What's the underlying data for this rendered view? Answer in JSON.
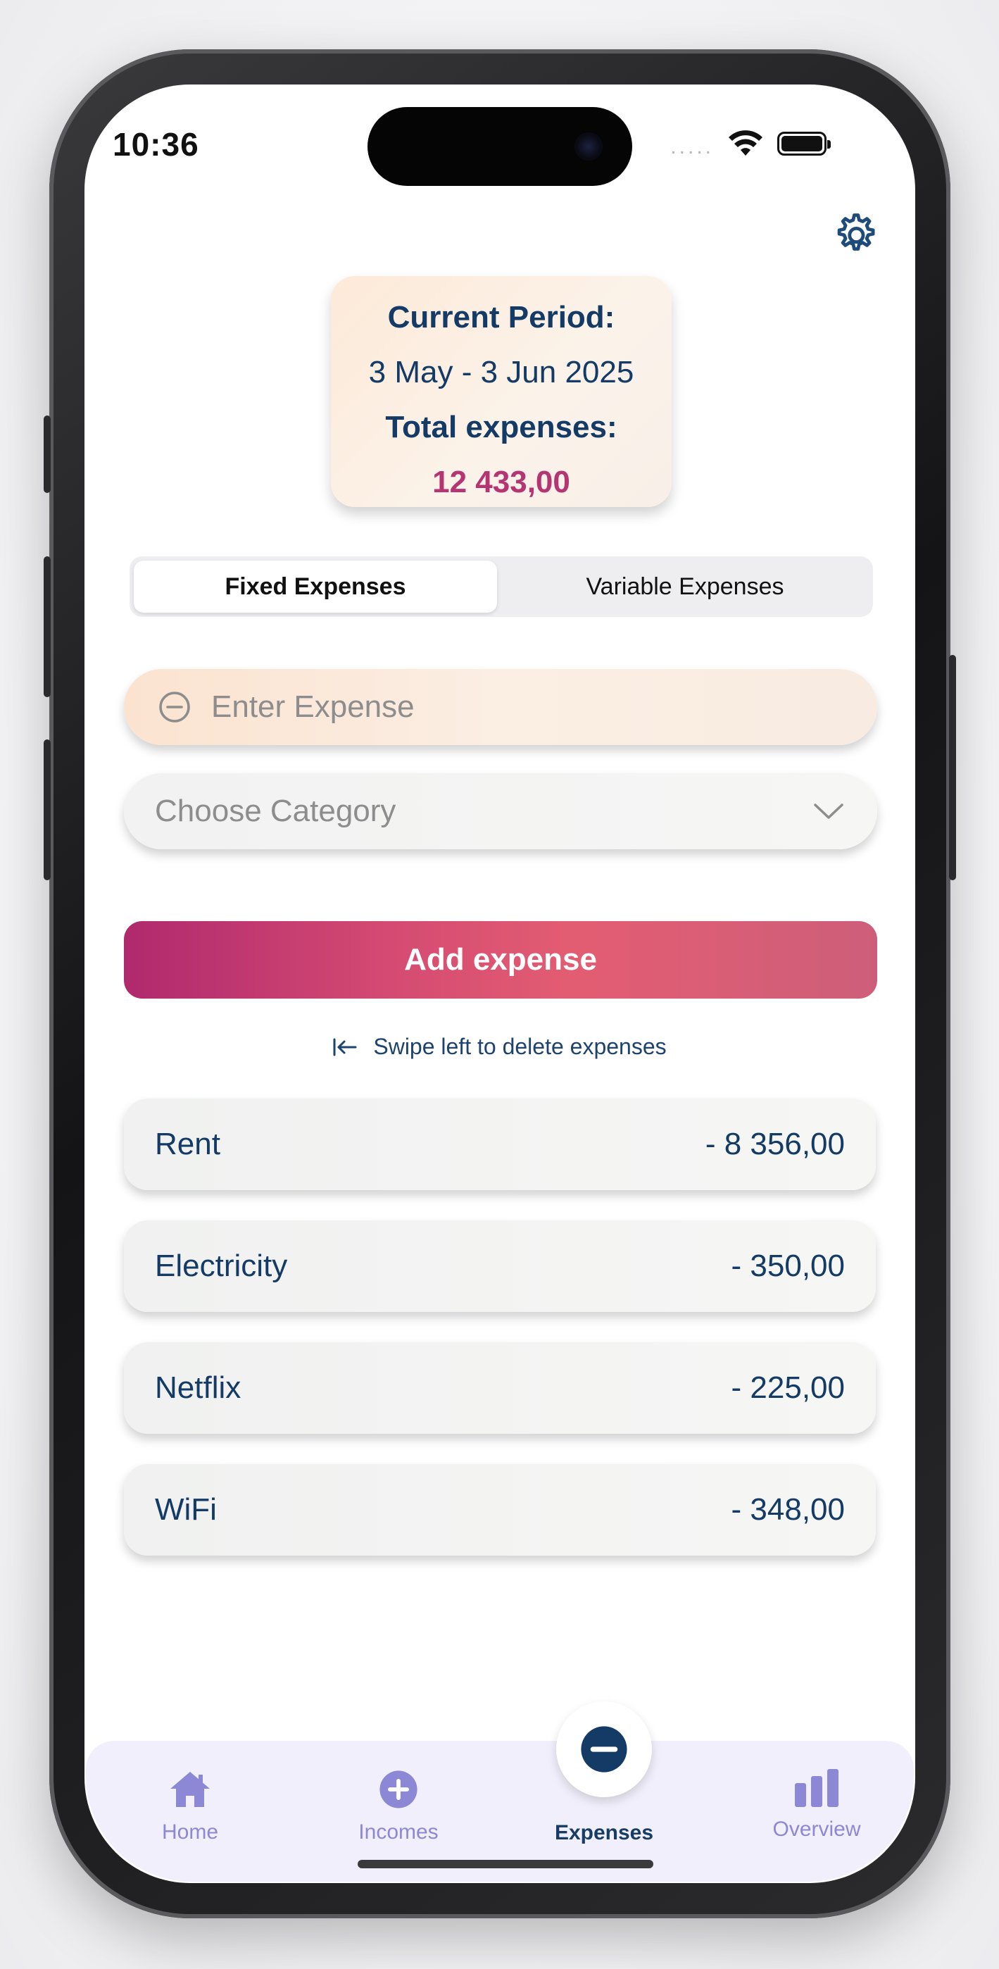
{
  "status_bar": {
    "time": "10:36",
    "signal": "....."
  },
  "summary": {
    "period_label": "Current Period:",
    "period_range": "3 May - 3 Jun 2025",
    "total_label": "Total expenses:",
    "total_value": "12 433,00"
  },
  "segments": {
    "fixed": "Fixed Expenses",
    "variable": "Variable Expenses",
    "selected": "fixed"
  },
  "form": {
    "expense_placeholder": "Enter Expense",
    "category_placeholder": "Choose Category",
    "add_label": "Add expense"
  },
  "hint": "Swipe left to delete expenses",
  "expenses": [
    {
      "name": "Rent",
      "amount": "- 8 356,00"
    },
    {
      "name": "Electricity",
      "amount": "- 350,00"
    },
    {
      "name": "Netflix",
      "amount": "- 225,00"
    },
    {
      "name": "WiFi",
      "amount": "- 348,00"
    }
  ],
  "tabs": {
    "home": "Home",
    "incomes": "Incomes",
    "expenses": "Expenses",
    "overview": "Overview",
    "active": "expenses"
  },
  "colors": {
    "navy": "#143a66",
    "accent_pink": "#b43572",
    "tab_inactive": "#8c88d6",
    "button_gradient_start": "#b0296e",
    "button_gradient_end": "#cd5e7a"
  },
  "icons": {
    "settings": "gear-icon",
    "expense_field": "minus-circle-icon",
    "category": "chevron-down-icon",
    "hint": "arrow-left-bar-icon",
    "home": "house-icon",
    "incomes": "plus-circle-icon",
    "expenses": "minus-circle-icon",
    "overview": "bar-chart-icon"
  }
}
